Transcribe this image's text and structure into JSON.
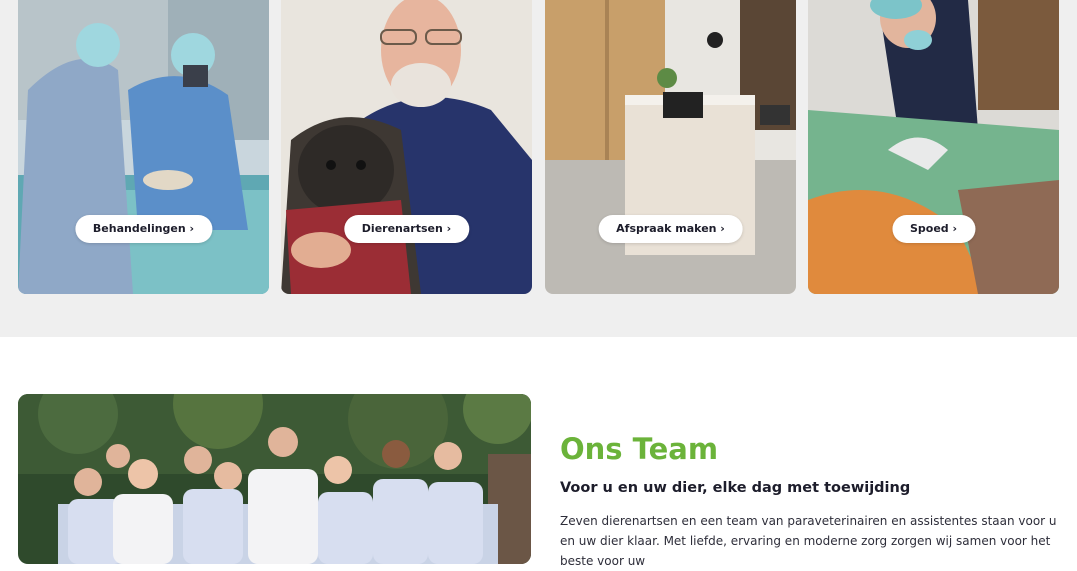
{
  "cards": [
    {
      "button_label": "Behandelingen ›"
    },
    {
      "button_label": "Dierenartsen ›"
    },
    {
      "button_label": "Afspraak maken ›"
    },
    {
      "button_label": "Spoed ›"
    }
  ],
  "team": {
    "title": "Ons Team",
    "subtitle": "Voor u en uw dier, elke dag met toewijding",
    "body": "Zeven dierenartsen en een team van paraveterinairen en assistentes staan voor u en uw dier klaar. Met liefde, ervaring en moderne zorg zorgen wij samen voor het beste voor uw"
  },
  "colors": {
    "accent_green": "#6bb33a",
    "heading_dark": "#1d1d2b",
    "section_bg": "#efefef"
  }
}
